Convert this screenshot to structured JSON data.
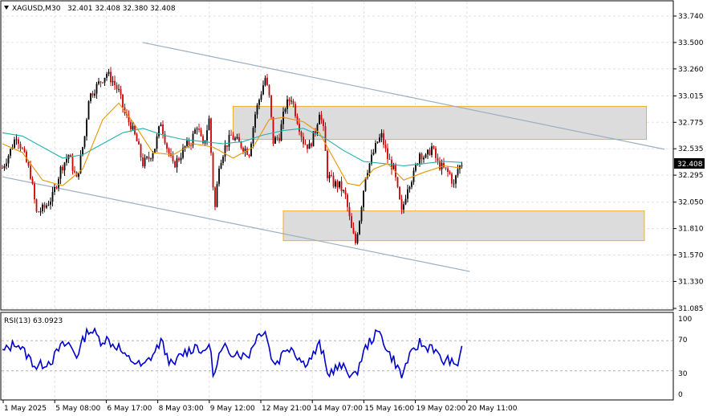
{
  "header": {
    "symbol": "XAGUSD,M30",
    "ohlc": "32.401 32.408 32.380 32.408",
    "dropdown_icon": "triangle-down-icon"
  },
  "rsi_header": "RSI(13) 63.0923",
  "colors": {
    "bull": "#000000",
    "bear": "#cc0000",
    "ma_fast": "#e69500",
    "ma_slow": "#20b2aa",
    "rsi": "#0000cc",
    "zone_fill": "#dcdcdc",
    "zone_border": "#f0b030",
    "channel": "#9ab0c0",
    "grid": "#e2e2e2",
    "price_tag_bg": "#000000",
    "price_tag_text": "#ffffff"
  },
  "chart_data": [
    {
      "type": "candlestick",
      "title": "XAGUSD,M30",
      "ylim": [
        31.085,
        33.74
      ],
      "price_ticks": [
        "33.740",
        "33.500",
        "33.260",
        "33.015",
        "32.775",
        "32.535",
        "32.295",
        "32.050",
        "31.810",
        "31.570",
        "31.330",
        "31.085"
      ],
      "x_ticks": [
        "1 May 2025",
        "5 May 08:00",
        "6 May 17:00",
        "8 May 03:00",
        "9 May 12:00",
        "12 May 21:00",
        "14 May 07:00",
        "15 May 16:00",
        "19 May 02:00",
        "20 May 11:00"
      ],
      "current_price": "32.408",
      "close_path": [
        [
          0,
          32.36
        ],
        [
          4,
          32.52
        ],
        [
          7,
          32.66
        ],
        [
          10,
          32.52
        ],
        [
          14,
          32.3
        ],
        [
          17,
          31.95
        ],
        [
          21,
          32.0
        ],
        [
          25,
          32.1
        ],
        [
          29,
          32.35
        ],
        [
          33,
          32.48
        ],
        [
          37,
          32.25
        ],
        [
          41,
          32.65
        ],
        [
          43,
          33.0
        ],
        [
          46,
          33.08
        ],
        [
          49,
          33.15
        ],
        [
          52,
          33.22
        ],
        [
          55,
          33.15
        ],
        [
          58,
          33.05
        ],
        [
          61,
          32.85
        ],
        [
          64,
          32.75
        ],
        [
          67,
          32.6
        ],
        [
          70,
          32.4
        ],
        [
          73,
          32.45
        ],
        [
          76,
          32.55
        ],
        [
          79,
          32.78
        ],
        [
          82,
          32.55
        ],
        [
          85,
          32.38
        ],
        [
          88,
          32.45
        ],
        [
          91,
          32.55
        ],
        [
          94,
          32.6
        ],
        [
          97,
          32.75
        ],
        [
          100,
          32.55
        ],
        [
          103,
          32.8
        ],
        [
          105,
          32.2
        ],
        [
          106,
          32.0
        ],
        [
          108,
          32.4
        ],
        [
          111,
          32.55
        ],
        [
          114,
          32.65
        ],
        [
          117,
          32.6
        ],
        [
          120,
          32.55
        ],
        [
          123,
          32.5
        ],
        [
          126,
          32.85
        ],
        [
          129,
          33.05
        ],
        [
          131,
          33.18
        ],
        [
          133,
          33.0
        ],
        [
          135,
          32.6
        ],
        [
          138,
          32.65
        ],
        [
          141,
          32.92
        ],
        [
          144,
          33.0
        ],
        [
          147,
          32.8
        ],
        [
          150,
          32.6
        ],
        [
          153,
          32.55
        ],
        [
          156,
          32.7
        ],
        [
          158,
          32.88
        ],
        [
          160,
          32.7
        ],
        [
          162,
          32.3
        ],
        [
          165,
          32.22
        ],
        [
          168,
          32.2
        ],
        [
          171,
          32.1
        ],
        [
          174,
          31.8
        ],
        [
          176,
          31.68
        ],
        [
          178,
          31.9
        ],
        [
          181,
          32.3
        ],
        [
          184,
          32.45
        ],
        [
          187,
          32.6
        ],
        [
          189,
          32.65
        ],
        [
          192,
          32.45
        ],
        [
          195,
          32.35
        ],
        [
          197,
          32.15
        ],
        [
          199,
          31.95
        ],
        [
          202,
          32.2
        ],
        [
          205,
          32.3
        ],
        [
          208,
          32.5
        ],
        [
          211,
          32.45
        ],
        [
          214,
          32.55
        ],
        [
          217,
          32.4
        ],
        [
          220,
          32.35
        ],
        [
          223,
          32.3
        ],
        [
          225,
          32.2
        ],
        [
          227,
          32.35
        ],
        [
          229,
          32.4
        ]
      ],
      "ma_fast": [
        [
          0,
          32.58
        ],
        [
          10,
          32.5
        ],
        [
          20,
          32.25
        ],
        [
          30,
          32.2
        ],
        [
          40,
          32.35
        ],
        [
          50,
          32.8
        ],
        [
          58,
          32.95
        ],
        [
          65,
          32.78
        ],
        [
          75,
          32.5
        ],
        [
          85,
          32.48
        ],
        [
          95,
          32.58
        ],
        [
          105,
          32.55
        ],
        [
          115,
          32.45
        ],
        [
          125,
          32.55
        ],
        [
          133,
          32.8
        ],
        [
          140,
          32.82
        ],
        [
          150,
          32.78
        ],
        [
          158,
          32.68
        ],
        [
          165,
          32.45
        ],
        [
          172,
          32.22
        ],
        [
          178,
          32.2
        ],
        [
          185,
          32.35
        ],
        [
          192,
          32.4
        ],
        [
          200,
          32.25
        ],
        [
          210,
          32.32
        ],
        [
          220,
          32.38
        ],
        [
          229,
          32.36
        ]
      ],
      "ma_slow": [
        [
          0,
          32.68
        ],
        [
          10,
          32.65
        ],
        [
          20,
          32.55
        ],
        [
          30,
          32.45
        ],
        [
          40,
          32.48
        ],
        [
          50,
          32.58
        ],
        [
          60,
          32.68
        ],
        [
          70,
          32.72
        ],
        [
          80,
          32.66
        ],
        [
          90,
          32.62
        ],
        [
          100,
          32.6
        ],
        [
          110,
          32.58
        ],
        [
          120,
          32.6
        ],
        [
          130,
          32.66
        ],
        [
          140,
          32.7
        ],
        [
          150,
          32.72
        ],
        [
          160,
          32.64
        ],
        [
          170,
          32.52
        ],
        [
          180,
          32.42
        ],
        [
          190,
          32.4
        ],
        [
          200,
          32.38
        ],
        [
          210,
          32.4
        ],
        [
          220,
          32.42
        ],
        [
          229,
          32.41
        ]
      ],
      "zones": [
        {
          "name": "resistance",
          "x0": 115,
          "x1": 321,
          "y0": 32.62,
          "y1": 32.92
        },
        {
          "name": "support",
          "x0": 140,
          "x1": 320,
          "y0": 31.7,
          "y1": 31.97
        }
      ],
      "channel_lines": [
        {
          "name": "upper",
          "x0": 70,
          "y0": 33.5,
          "x1": 330,
          "y1": 32.53
        },
        {
          "name": "lower",
          "x0": 0,
          "y0": 32.28,
          "x1": 233,
          "y1": 31.42
        }
      ]
    },
    {
      "type": "line",
      "title": "RSI(13) 63.0923",
      "ylim": [
        0,
        100
      ],
      "ticks": [
        "100",
        "70",
        "30",
        "0"
      ],
      "levels": [
        70,
        30
      ],
      "values": [
        [
          0,
          55
        ],
        [
          4,
          62
        ],
        [
          7,
          68
        ],
        [
          10,
          58
        ],
        [
          14,
          45
        ],
        [
          17,
          35
        ],
        [
          21,
          40
        ],
        [
          25,
          45
        ],
        [
          29,
          62
        ],
        [
          33,
          66
        ],
        [
          37,
          50
        ],
        [
          41,
          75
        ],
        [
          43,
          85
        ],
        [
          46,
          80
        ],
        [
          49,
          70
        ],
        [
          52,
          72
        ],
        [
          55,
          65
        ],
        [
          58,
          62
        ],
        [
          61,
          48
        ],
        [
          64,
          45
        ],
        [
          67,
          40
        ],
        [
          70,
          35
        ],
        [
          73,
          45
        ],
        [
          76,
          55
        ],
        [
          79,
          70
        ],
        [
          82,
          50
        ],
        [
          85,
          35
        ],
        [
          88,
          48
        ],
        [
          91,
          55
        ],
        [
          94,
          58
        ],
        [
          97,
          65
        ],
        [
          100,
          50
        ],
        [
          103,
          68
        ],
        [
          105,
          30
        ],
        [
          106,
          25
        ],
        [
          108,
          50
        ],
        [
          111,
          60
        ],
        [
          114,
          55
        ],
        [
          117,
          55
        ],
        [
          120,
          50
        ],
        [
          123,
          52
        ],
        [
          126,
          72
        ],
        [
          129,
          82
        ],
        [
          131,
          84
        ],
        [
          133,
          60
        ],
        [
          135,
          40
        ],
        [
          138,
          45
        ],
        [
          141,
          60
        ],
        [
          144,
          62
        ],
        [
          147,
          50
        ],
        [
          150,
          40
        ],
        [
          153,
          45
        ],
        [
          156,
          55
        ],
        [
          158,
          65
        ],
        [
          160,
          50
        ],
        [
          162,
          25
        ],
        [
          165,
          32
        ],
        [
          168,
          35
        ],
        [
          171,
          33
        ],
        [
          174,
          25
        ],
        [
          176,
          22
        ],
        [
          178,
          40
        ],
        [
          181,
          60
        ],
        [
          184,
          72
        ],
        [
          187,
          80
        ],
        [
          189,
          78
        ],
        [
          192,
          55
        ],
        [
          195,
          45
        ],
        [
          197,
          35
        ],
        [
          199,
          22
        ],
        [
          202,
          45
        ],
        [
          205,
          55
        ],
        [
          208,
          68
        ],
        [
          211,
          60
        ],
        [
          214,
          65
        ],
        [
          217,
          50
        ],
        [
          220,
          42
        ],
        [
          223,
          45
        ],
        [
          225,
          35
        ],
        [
          227,
          40
        ],
        [
          229,
          63
        ]
      ]
    }
  ]
}
